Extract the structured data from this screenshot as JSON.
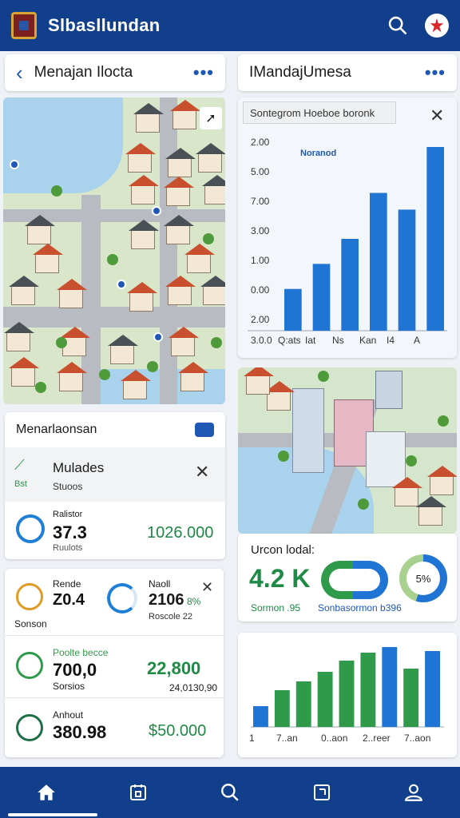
{
  "app": {
    "title": "Slbasllundan",
    "logo_icon": "crest-icon",
    "search_icon": "search-icon",
    "avatar_icon": "emblem-icon"
  },
  "map_card": {
    "title": "Menajan Ilocta",
    "more": "•••"
  },
  "chart_card": {
    "title": "IMandajUmesa",
    "more": "•••",
    "overlay_title": "Sontegrom Hoeboe boronk",
    "series_label": "Noranod",
    "chart_data": {
      "type": "bar",
      "title": "Sontegrom Hoeboe boronk",
      "y_tick_labels": [
        "2.00",
        "5.00",
        "7.00",
        "3.00",
        "1.00",
        "0.00",
        "2.00"
      ],
      "categories": [
        "3.0.0",
        "Q:ats",
        "Iat",
        "Ns",
        "Kan",
        "I4",
        "A"
      ],
      "values": [
        1.0,
        1.6,
        2.2,
        3.3,
        2.9,
        4.4
      ],
      "colors": [
        "#1f74d4",
        "#1f74d4",
        "#1f74d4",
        "#1f74d4",
        "#1f74d4",
        "#1f74d4"
      ]
    }
  },
  "maintenance_card": {
    "title": "Menarlaonsan",
    "row1": {
      "label": "Mulades",
      "sub": "Stuoos",
      "badge": "Bst"
    },
    "row2": {
      "caption": "Ralistor",
      "value": "37.3",
      "sub": "Ruulots",
      "right_value": "1026.000"
    }
  },
  "urban_card": {
    "caption": "Urcon lodal:",
    "big_value": "4.2 K",
    "sub_left": "Sormon .95",
    "sub_right": "Sonbasormon b396",
    "donut_percent": "5%",
    "donut_value": 0.55
  },
  "stats_card": {
    "row1": {
      "title": "Rende",
      "value": "Z0.4",
      "sub": "Sonson",
      "title2": "Naoll",
      "value2": "2106",
      "value2_suffix": "8%",
      "sub2": "Roscole 22"
    },
    "row2": {
      "title": "Poolte becce",
      "value": "700,0",
      "sub": "Sorsios",
      "right_value": "22,800",
      "right_sub": "24,0130,90"
    },
    "row3": {
      "title": "Anhout",
      "value": "380.98",
      "right_value": "$50.000"
    }
  },
  "bottom_chart": {
    "chart_data": {
      "type": "bar",
      "categories": [
        "1",
        "7..an",
        "0..aon",
        "2..reer",
        "7..aon"
      ],
      "values": [
        0.26,
        0.46,
        0.57,
        0.69,
        0.83,
        0.93,
        1.0,
        0.73,
        0.95
      ],
      "colors": [
        "#1f74d4",
        "#2e9a4a",
        "#2e9a4a",
        "#2e9a4a",
        "#2e9a4a",
        "#2e9a4a",
        "#1f74d4",
        "#2e9a4a",
        "#1f74d4"
      ]
    }
  },
  "bottom_nav": [
    "home-icon",
    "calendar-icon",
    "search-icon",
    "square-icon",
    "user-icon"
  ]
}
